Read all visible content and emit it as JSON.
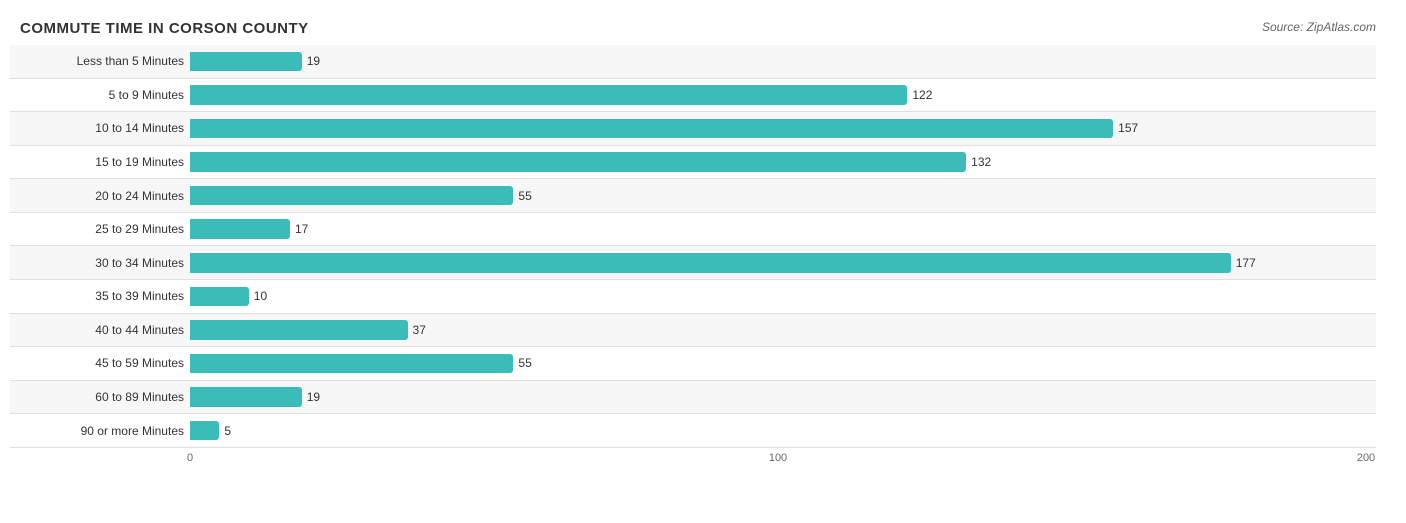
{
  "title": "COMMUTE TIME IN CORSON COUNTY",
  "source": "Source: ZipAtlas.com",
  "maxValue": 200,
  "xTicks": [
    {
      "label": "0",
      "value": 0
    },
    {
      "label": "100",
      "value": 100
    },
    {
      "label": "200",
      "value": 200
    }
  ],
  "bars": [
    {
      "label": "Less than 5 Minutes",
      "value": 19
    },
    {
      "label": "5 to 9 Minutes",
      "value": 122
    },
    {
      "label": "10 to 14 Minutes",
      "value": 157
    },
    {
      "label": "15 to 19 Minutes",
      "value": 132
    },
    {
      "label": "20 to 24 Minutes",
      "value": 55
    },
    {
      "label": "25 to 29 Minutes",
      "value": 17
    },
    {
      "label": "30 to 34 Minutes",
      "value": 177
    },
    {
      "label": "35 to 39 Minutes",
      "value": 10
    },
    {
      "label": "40 to 44 Minutes",
      "value": 37
    },
    {
      "label": "45 to 59 Minutes",
      "value": 55
    },
    {
      "label": "60 to 89 Minutes",
      "value": 19
    },
    {
      "label": "90 or more Minutes",
      "value": 5
    }
  ],
  "barColor": "#3bbcb8"
}
